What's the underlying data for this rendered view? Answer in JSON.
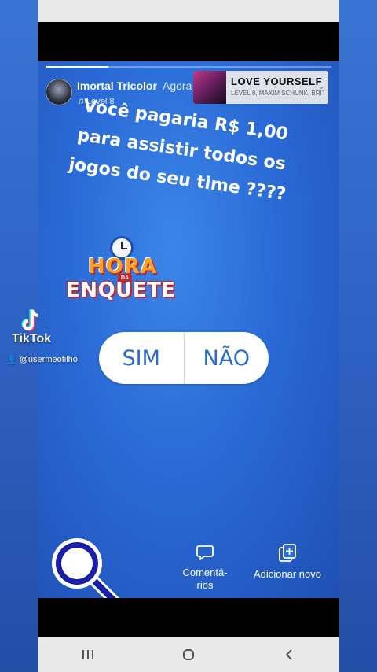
{
  "story": {
    "username": "Imortal Tricolor",
    "time": "Agora mesmo",
    "music_label": "Level 8",
    "progress": 0.22,
    "question_lines": [
      "Você pagaria R$ 1,00",
      "para assistir todos os",
      "jogos do seu time ????"
    ]
  },
  "music_sticker": {
    "title": "LOVE YOURSELF",
    "artist": "LEVEL 8, MAXIM SCHUNK, BRIT"
  },
  "sticker": {
    "hora": "HORA",
    "da": "DA",
    "enquete": "ENQUETE"
  },
  "poll": {
    "option_yes": "SIM",
    "option_no": "NÃO"
  },
  "actions": {
    "comments_line1": "Comentá-",
    "comments_line2": "rios",
    "add_new": "Adicionar novo"
  },
  "watermark": {
    "brand": "TikTok",
    "handle": "@usermeofilho"
  },
  "colors": {
    "story_bg": "#2a6ad6",
    "poll_text": "#2a6ad6",
    "sticker_orange": "#f6a32a",
    "sticker_red": "#c0262d"
  }
}
